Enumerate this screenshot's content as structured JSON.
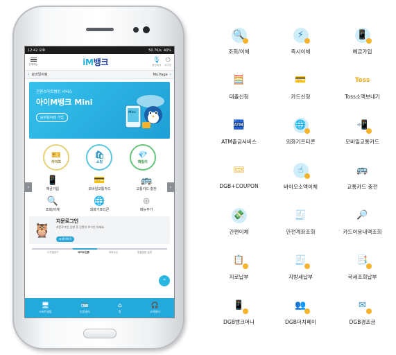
{
  "status_bar": {
    "time": "12:42 오후",
    "info": "50.7K/s",
    "battery": "40%"
  },
  "app_bar": {
    "menu_label": "전체메뉴",
    "logo_prefix": "iM",
    "logo_suffix": "뱅크",
    "right_icons": [
      {
        "label": "음성비서",
        "icon": "microphone-icon"
      },
      {
        "label": "로그인",
        "icon": "power-icon"
      }
    ]
  },
  "breadcrumb": {
    "left": "모바일지점",
    "right": "My Page"
  },
  "banner": {
    "subtitle": "간편스마트뱅킹 서비스",
    "title": "아이M뱅크 Mini",
    "button": "모바일지점 가입",
    "mascot_tag": "Mini"
  },
  "quick_menu": [
    {
      "label": "라이프",
      "icon": "ticket-icon"
    },
    {
      "label": "쇼핑",
      "icon": "shopping-bag-icon"
    },
    {
      "label": "패밀리",
      "icon": "diamond-icon"
    }
  ],
  "grid_menu": [
    {
      "label": "예금가입",
      "icon": "phone-coin-icon"
    },
    {
      "label": "모바일교통카드",
      "icon": "transit-card-icon"
    },
    {
      "label": "교통카드 충전",
      "icon": "bus-icon"
    },
    {
      "label": "조회/이체",
      "icon": "search-coin-icon"
    },
    {
      "label": "외화기프티콘",
      "icon": "globe-gift-icon"
    },
    {
      "label": "메뉴추가",
      "icon": "plus-icon"
    }
  ],
  "fingerprint": {
    "title": "지문로그인",
    "desc": "지문로그인 신청 후 간편히 로그인 하세요.",
    "button": "자세히보기"
  },
  "steps": [
    "디지털창구",
    "바이오인증",
    "외화송금",
    "환율알림 설정"
  ],
  "steps_active_index": 1,
  "tab_bar": [
    {
      "label": "스마트뱅킹",
      "icon": "monitor-icon"
    },
    {
      "label": "인증센터",
      "icon": "certificate-icon"
    },
    {
      "label": "홈",
      "icon": "home-icon"
    },
    {
      "label": "고객센터",
      "icon": "headset-icon"
    }
  ],
  "services": [
    {
      "label": "조회/이체",
      "icon": "search-coin-icon"
    },
    {
      "label": "즉시이체",
      "icon": "lightning-transfer-icon"
    },
    {
      "label": "예금가입",
      "icon": "phone-coin-icon"
    },
    {
      "label": "대출신청",
      "icon": "calculator-icon"
    },
    {
      "label": "카드신청",
      "icon": "card-icon"
    },
    {
      "label": "Toss소액보내기",
      "icon": "toss-send-icon",
      "brand_text": "Toss"
    },
    {
      "label": "ATM출금서비스",
      "icon": "atm-icon"
    },
    {
      "label": "외화기프티콘",
      "icon": "globe-gift-icon"
    },
    {
      "label": "모바일교통카드",
      "icon": "transit-card-icon"
    },
    {
      "label": "DGB+COUPON",
      "icon": "coupon-icon"
    },
    {
      "label": "바이오소액이체",
      "icon": "bio-transfer-icon"
    },
    {
      "label": "교통카드 충전",
      "icon": "bus-icon"
    },
    {
      "label": "간편이체",
      "icon": "easy-transfer-icon"
    },
    {
      "label": "안전계좌조회",
      "icon": "safe-account-icon"
    },
    {
      "label": "카드이용내역조회",
      "icon": "card-history-icon"
    },
    {
      "label": "지로납부",
      "icon": "giro-icon"
    },
    {
      "label": "지방세납부",
      "icon": "local-tax-icon"
    },
    {
      "label": "국세조회납부",
      "icon": "national-tax-icon"
    },
    {
      "label": "DGB뱅크머니",
      "icon": "bank-money-icon"
    },
    {
      "label": "DGB더치페이",
      "icon": "dutch-pay-icon"
    },
    {
      "label": "DGB경조금",
      "icon": "gift-envelope-icon"
    }
  ],
  "colors": {
    "primary": "#23a9dc",
    "brand_navy": "#1f3fa0",
    "accent": "#f4b32a"
  }
}
